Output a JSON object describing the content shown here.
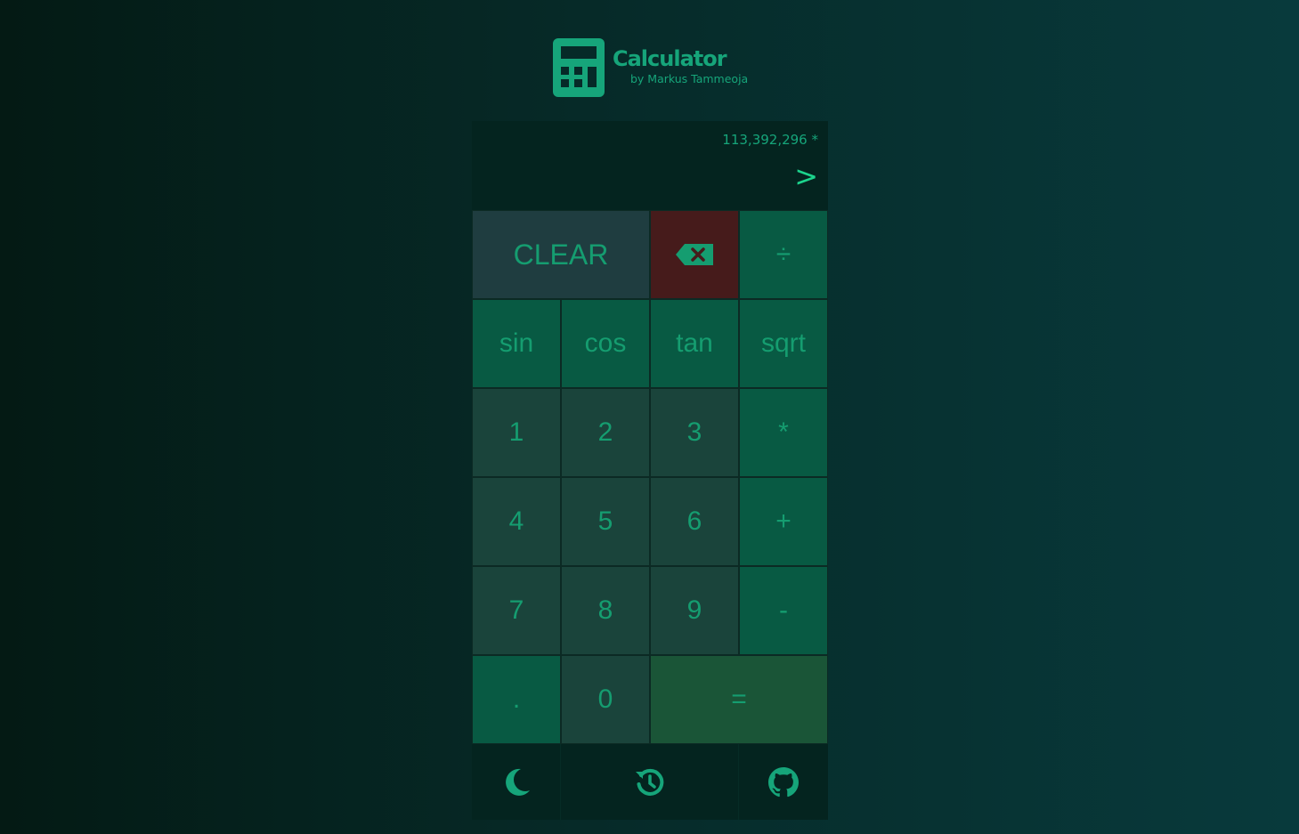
{
  "header": {
    "title": "Calculator",
    "subtitle": "by Markus Tammeoja"
  },
  "display": {
    "history": "113,392,296 *",
    "input_prompt": ">"
  },
  "keys": {
    "clear": "CLEAR",
    "divide": "÷",
    "sin": "sin",
    "cos": "cos",
    "tan": "tan",
    "sqrt": "sqrt",
    "one": "1",
    "two": "2",
    "three": "3",
    "multiply": "*",
    "four": "4",
    "five": "5",
    "six": "6",
    "plus": "+",
    "seven": "7",
    "eight": "8",
    "nine": "9",
    "minus": "-",
    "dot": ".",
    "zero": "0",
    "equals": "="
  },
  "icons": {
    "logo": "calculator-icon",
    "backspace": "backspace-icon",
    "theme": "moon-icon",
    "history": "history-icon",
    "github": "github-icon"
  },
  "colors": {
    "accent": "#16a57a",
    "number_key": "#1a443b",
    "operator_key": "#085a43",
    "clear_key": "#1f3d40",
    "backspace_key": "#461b1b",
    "equals_key": "#1a5537",
    "display_bg": "#04241f"
  }
}
